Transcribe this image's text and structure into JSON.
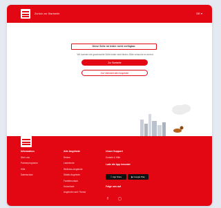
{
  "header": {
    "tagline": "Zurück zur Startseite",
    "language": "DE ▾"
  },
  "main": {
    "headline": "Diese Seite ist leider nicht verfügbar.",
    "subtext": "Wir konnten die gewünschte Seite leider nicht finden. Bitte versuche es erneut.",
    "primary_button": "Zur Startseite",
    "secondary_button": "Zur Übersicht aller Angebote"
  },
  "footer": {
    "columns": [
      {
        "heading": "Information",
        "items": [
          "Über uns",
          "Partnerprogramm",
          "Hilfe",
          "Datenschutz"
        ]
      },
      {
        "heading": "Alle Angebote",
        "items": [
          "Reisen",
          "Lastminute",
          "Wellness-Angebote",
          "Städte-Angebote",
          "Familienurlaub",
          "Kurzurlaub",
          "Angebote nach Thema"
        ]
      },
      {
        "heading": "Unser Support",
        "contact": "Kontakt & Hilfe",
        "apps_label": "Lade die App herunter",
        "apps": [
          "App Store",
          "Google Play"
        ],
        "follow_label": "Folge uns auf",
        "social_icons": [
          "facebook-icon",
          "instagram-icon"
        ]
      }
    ]
  },
  "colors": {
    "brand": "#e30613",
    "background": "#e4e9f2"
  }
}
